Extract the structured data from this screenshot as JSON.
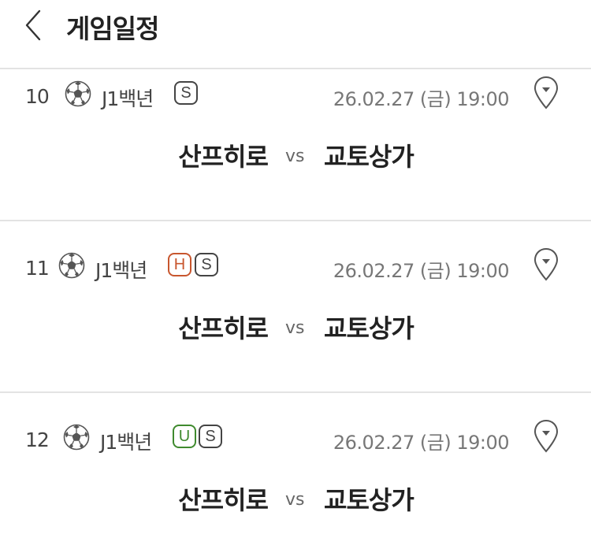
{
  "header": {
    "title": "게임일정",
    "back_icon": "chevron-left-icon"
  },
  "games": [
    {
      "number": "10",
      "sport_icon": "soccer-ball-icon",
      "league": "J1백년",
      "badges": [
        {
          "text": "S",
          "color": "#444444"
        }
      ],
      "datetime": "26.02.27 (금) 19:00",
      "home": "산프히로",
      "vs": "vs",
      "away": "교토상가",
      "location_icon": "map-pin-icon"
    },
    {
      "number": "11",
      "sport_icon": "soccer-ball-icon",
      "league": "J1백년",
      "badges": [
        {
          "text": "H",
          "color": "#c8562e"
        },
        {
          "text": "S",
          "color": "#444444"
        }
      ],
      "datetime": "26.02.27 (금) 19:00",
      "home": "산프히로",
      "vs": "vs",
      "away": "교토상가",
      "location_icon": "map-pin-icon"
    },
    {
      "number": "12",
      "sport_icon": "soccer-ball-icon",
      "league": "J1백년",
      "badges": [
        {
          "text": "U",
          "color": "#3f8a2e"
        },
        {
          "text": "S",
          "color": "#444444"
        }
      ],
      "datetime": "26.02.27 (금) 19:00",
      "home": "산프히로",
      "vs": "vs",
      "away": "교토상가",
      "location_icon": "map-pin-icon"
    }
  ]
}
